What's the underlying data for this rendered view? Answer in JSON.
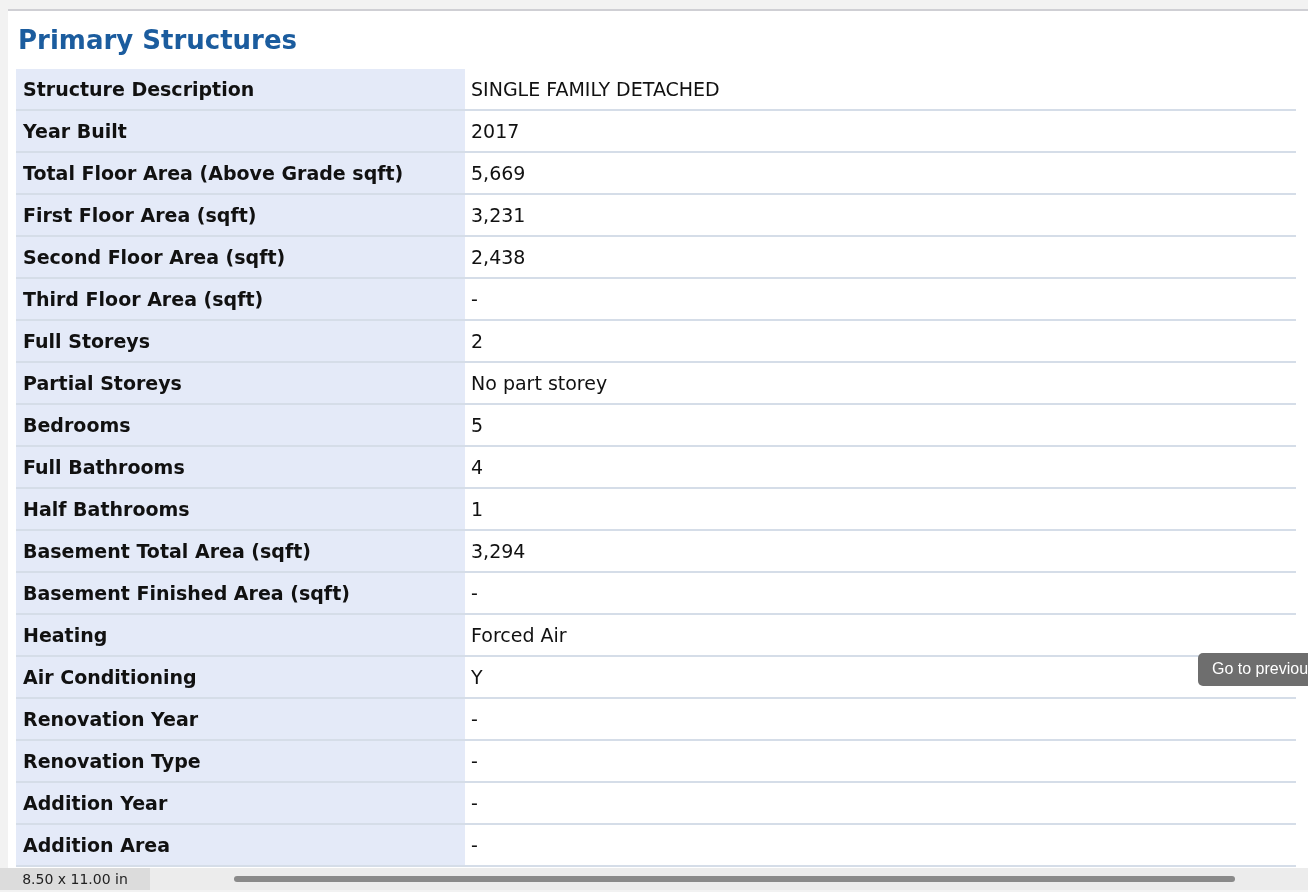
{
  "section_title": "Primary Structures",
  "rows": [
    {
      "label": "Structure Description",
      "value": "SINGLE FAMILY DETACHED"
    },
    {
      "label": "Year Built",
      "value": "2017"
    },
    {
      "label": "Total Floor Area (Above Grade sqft)",
      "value": "5,669"
    },
    {
      "label": "First Floor Area (sqft)",
      "value": "3,231"
    },
    {
      "label": "Second Floor Area (sqft)",
      "value": "2,438"
    },
    {
      "label": "Third Floor Area (sqft)",
      "value": "-"
    },
    {
      "label": "Full Storeys",
      "value": "2"
    },
    {
      "label": "Partial Storeys",
      "value": "No part storey"
    },
    {
      "label": "Bedrooms",
      "value": "5"
    },
    {
      "label": "Full Bathrooms",
      "value": "4"
    },
    {
      "label": "Half Bathrooms",
      "value": "1"
    },
    {
      "label": "Basement Total Area (sqft)",
      "value": "3,294"
    },
    {
      "label": "Basement Finished Area (sqft)",
      "value": "-"
    },
    {
      "label": "Heating",
      "value": "Forced Air"
    },
    {
      "label": "Air Conditioning",
      "value": "Y"
    },
    {
      "label": "Renovation Year",
      "value": "-"
    },
    {
      "label": "Renovation Type",
      "value": "-"
    },
    {
      "label": "Addition Year",
      "value": "-"
    },
    {
      "label": "Addition Area",
      "value": "-"
    }
  ],
  "tooltip": "Go to previou",
  "status_bar": {
    "page_size": "8.50 x 11.00 in"
  }
}
